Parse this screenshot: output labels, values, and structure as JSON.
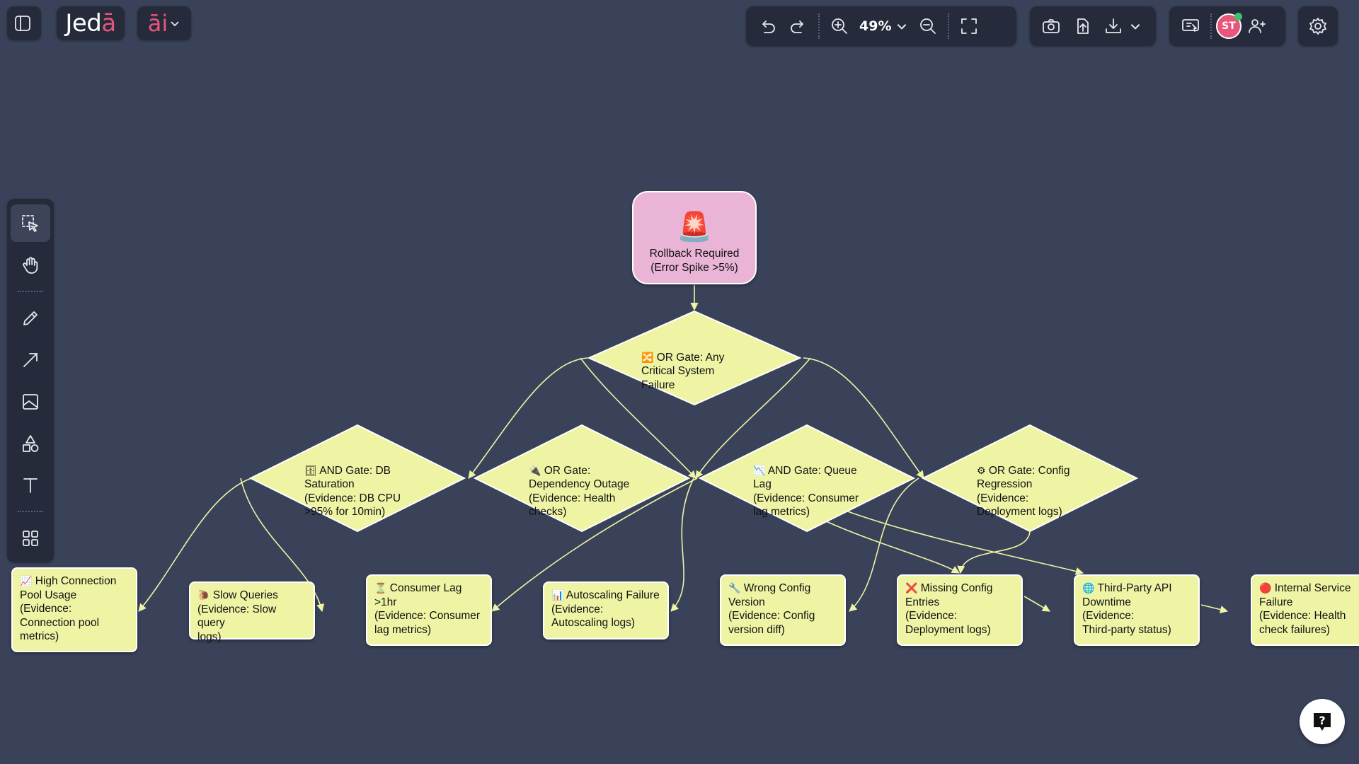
{
  "app": {
    "brand_prefix": "Jed",
    "brand_accent": "ā",
    "ai_label": "āi",
    "zoom": "49%",
    "avatar_initials": "ST"
  },
  "icons": {
    "sidebar_toggle": "sidebar-toggle-icon",
    "undo": "undo-icon",
    "redo": "redo-icon",
    "zoom_in": "zoom-in-icon",
    "zoom_out": "zoom-out-icon",
    "fit": "fit-screen-icon",
    "camera": "camera-icon",
    "upload": "upload-icon",
    "download": "download-icon",
    "share_screen": "screen-share-icon",
    "add_user": "add-user-icon",
    "settings": "gear-icon",
    "help": "help-icon"
  },
  "colors": {
    "canvas": "#3a4259",
    "toolbar": "#262b3b",
    "accent": "#e8557b",
    "node_fill": "#eef4a4",
    "root_fill": "#e9b4d6"
  },
  "diagram": {
    "root": {
      "icon": "🚨",
      "line1": "Rollback Required",
      "line2": "(Error Spike >5%)"
    },
    "gates": [
      {
        "id": "g0",
        "icon": "🔀",
        "text": "OR Gate: Any\nCritical System\nFailure"
      },
      {
        "id": "g1",
        "icon": "🗄",
        "text": "AND Gate: DB\nSaturation\n(Evidence: DB CPU\n>95% for 10min)"
      },
      {
        "id": "g2",
        "icon": "🔌",
        "text": "OR Gate:\nDependency Outage\n(Evidence: Health\nchecks)"
      },
      {
        "id": "g3",
        "icon": "📉",
        "text": "AND Gate: Queue\nLag\n(Evidence: Consumer\nlag metrics)"
      },
      {
        "id": "g4",
        "icon": "⚙",
        "text": "OR Gate: Config\nRegression\n(Evidence:\nDeployment logs)"
      }
    ],
    "leaves": [
      {
        "id": "l0",
        "icon": "📈",
        "text": "High Connection\nPool Usage\n(Evidence:\nConnection pool\nmetrics)"
      },
      {
        "id": "l1",
        "icon": "🐌",
        "text": "Slow Queries\n(Evidence: Slow query\nlogs)"
      },
      {
        "id": "l2",
        "icon": "⏳",
        "text": "Consumer Lag\n>1hr\n(Evidence: Consumer\nlag metrics)"
      },
      {
        "id": "l3",
        "icon": "📊",
        "text": "Autoscaling Failure\n(Evidence:\nAutoscaling logs)"
      },
      {
        "id": "l4",
        "icon": "🔧",
        "text": "Wrong Config\nVersion\n(Evidence: Config\nversion diff)"
      },
      {
        "id": "l5",
        "icon": "❌",
        "text": "Missing Config\nEntries\n(Evidence:\nDeployment logs)"
      },
      {
        "id": "l6",
        "icon": "🌐",
        "text": "Third-Party API\nDowntime\n(Evidence:\nThird-party status)"
      },
      {
        "id": "l7",
        "icon": "🔴",
        "text": "Internal Service\nFailure\n(Evidence: Health\ncheck failures)"
      }
    ]
  }
}
